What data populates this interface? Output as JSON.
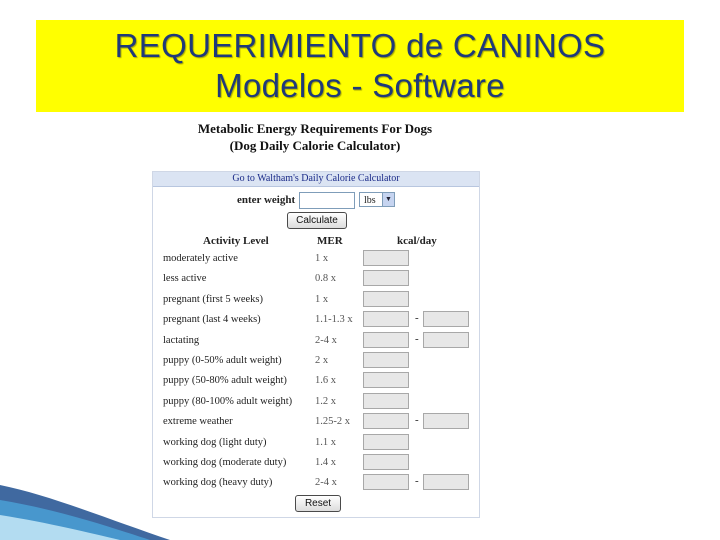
{
  "slide": {
    "title_line1": "REQUERIMIENTO de CANINOS",
    "title_line2": "Modelos - Software",
    "title_bg": "#ffff00",
    "title_color": "#1f3a7a"
  },
  "calculator": {
    "heading_line1": "Metabolic Energy Requirements For Dogs",
    "heading_line2": "(Dog Daily Calorie Calculator)",
    "top_link": "Go to Waltham's Daily Calorie Calculator",
    "weight_label": "enter weight",
    "weight_value": "",
    "unit_selected": "lbs",
    "calculate_label": "Calculate",
    "reset_label": "Reset",
    "columns": {
      "activity": "Activity Level",
      "mer": "MER",
      "kcal": "kcal/day"
    },
    "rows": [
      {
        "activity": "moderately active",
        "mer": "1 x",
        "range": false
      },
      {
        "activity": "less active",
        "mer": "0.8 x",
        "range": false
      },
      {
        "activity": "pregnant (first 5 weeks)",
        "mer": "1 x",
        "range": false
      },
      {
        "activity": "pregnant (last 4 weeks)",
        "mer": "1.1-1.3 x",
        "range": true
      },
      {
        "activity": "lactating",
        "mer": "2-4 x",
        "range": true
      },
      {
        "activity": "puppy (0-50% adult weight)",
        "mer": "2 x",
        "range": false
      },
      {
        "activity": "puppy (50-80% adult weight)",
        "mer": "1.6 x",
        "range": false
      },
      {
        "activity": "puppy (80-100% adult weight)",
        "mer": "1.2 x",
        "range": false
      },
      {
        "activity": "extreme weather",
        "mer": "1.25-2 x",
        "range": true
      },
      {
        "activity": "working dog (light duty)",
        "mer": "1.1 x",
        "range": false
      },
      {
        "activity": "working dog (moderate duty)",
        "mer": "1.4 x",
        "range": false
      },
      {
        "activity": "working dog (heavy duty)",
        "mer": "2-4 x",
        "range": true
      }
    ],
    "range_separator": "-"
  }
}
